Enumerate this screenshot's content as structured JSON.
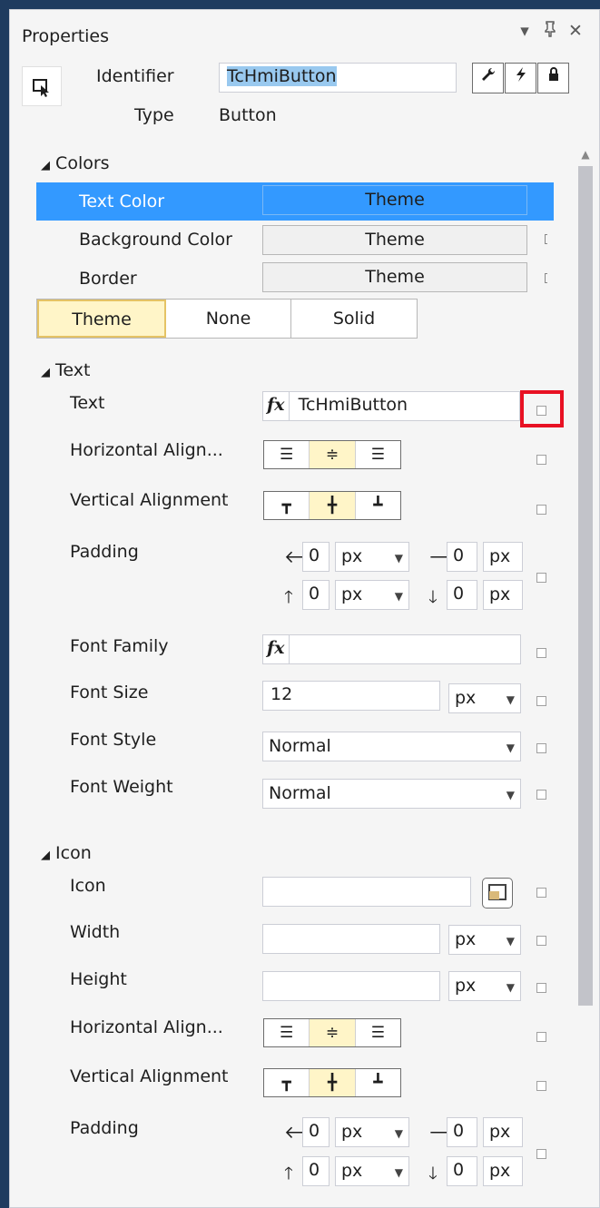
{
  "window": {
    "title": "Properties",
    "controls": [
      "▾",
      "ᴘ",
      "✕"
    ]
  },
  "header": {
    "identifier_label": "Identifier",
    "identifier_value": "TcHmiButton",
    "type_label": "Type",
    "type_value": "Button",
    "tools": [
      "wrench-icon",
      "lightning-icon",
      "lock-icon"
    ]
  },
  "colors": {
    "section": "Colors",
    "rows": [
      {
        "label": "Text Color",
        "value": "Theme"
      },
      {
        "label": "Background Color",
        "value": "Theme"
      },
      {
        "label": "Border",
        "value": "Theme"
      }
    ],
    "modes": [
      "Theme",
      "None",
      "Solid"
    ],
    "selected_mode": "Theme",
    "selection_color": "#3399ff"
  },
  "text": {
    "section": "Text",
    "text_label": "Text",
    "text_value": "TcHmiButton",
    "fx": "fx",
    "h_align_label": "Horizontal Align...",
    "v_align_label": "Vertical Alignment",
    "padding_label": "Padding",
    "padding": {
      "left": "0",
      "right": "0",
      "top": "0",
      "bottom": "0",
      "unit": "px"
    },
    "font_family_label": "Font Family",
    "font_family_value": "",
    "font_size_label": "Font Size",
    "font_size_value": "12",
    "font_size_unit": "px",
    "font_style_label": "Font Style",
    "font_style_value": "Normal",
    "font_weight_label": "Font Weight",
    "font_weight_value": "Normal"
  },
  "icon": {
    "section": "Icon",
    "icon_label": "Icon",
    "width_label": "Width",
    "width_unit": "px",
    "height_label": "Height",
    "height_unit": "px",
    "h_align_label": "Horizontal Align...",
    "v_align_label": "Vertical Alignment",
    "padding_label": "Padding",
    "padding": {
      "left": "0",
      "right": "0",
      "top": "0",
      "bottom": "0",
      "unit": "px"
    }
  },
  "accent": {
    "highlight_box": "#e81123",
    "active_toggle": "#fff5c8"
  }
}
